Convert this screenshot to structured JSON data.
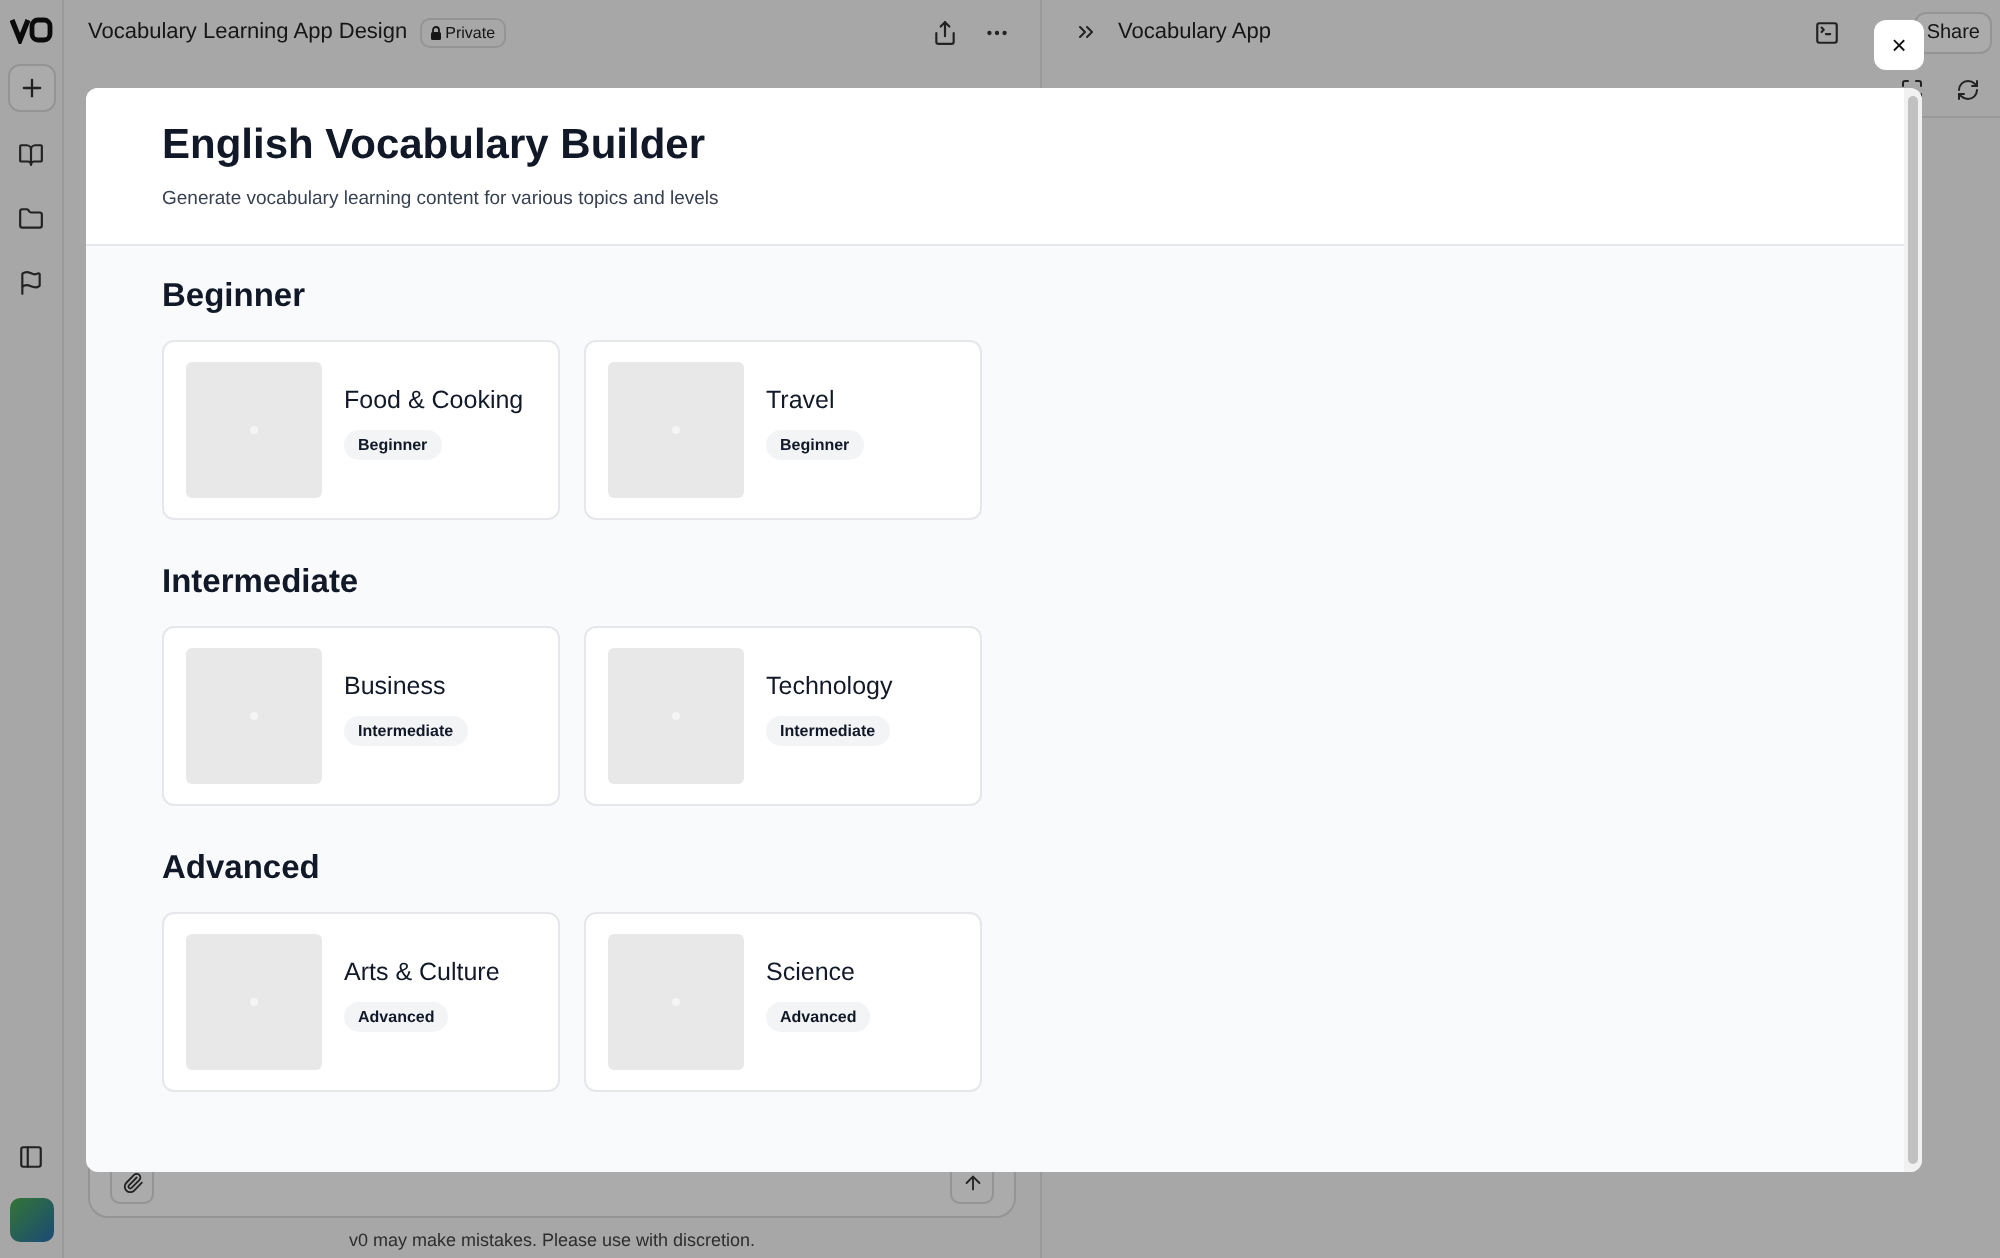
{
  "chat": {
    "title": "Vocabulary Learning App Design",
    "visibility": "Private",
    "disclaimer": "v0 may make mistakes. Please use with discretion."
  },
  "preview": {
    "title": "Vocabulary App",
    "share_label": "Share"
  },
  "modal": {
    "close_label": "×",
    "title": "English Vocabulary Builder",
    "subtitle": "Generate vocabulary learning content for various topics and levels",
    "sections": [
      {
        "heading": "Beginner",
        "topics": [
          {
            "name": "Food & Cooking",
            "level": "Beginner"
          },
          {
            "name": "Travel",
            "level": "Beginner"
          }
        ]
      },
      {
        "heading": "Intermediate",
        "topics": [
          {
            "name": "Business",
            "level": "Intermediate"
          },
          {
            "name": "Technology",
            "level": "Intermediate"
          }
        ]
      },
      {
        "heading": "Advanced",
        "topics": [
          {
            "name": "Arts & Culture",
            "level": "Advanced"
          },
          {
            "name": "Science",
            "level": "Advanced"
          }
        ]
      }
    ]
  }
}
